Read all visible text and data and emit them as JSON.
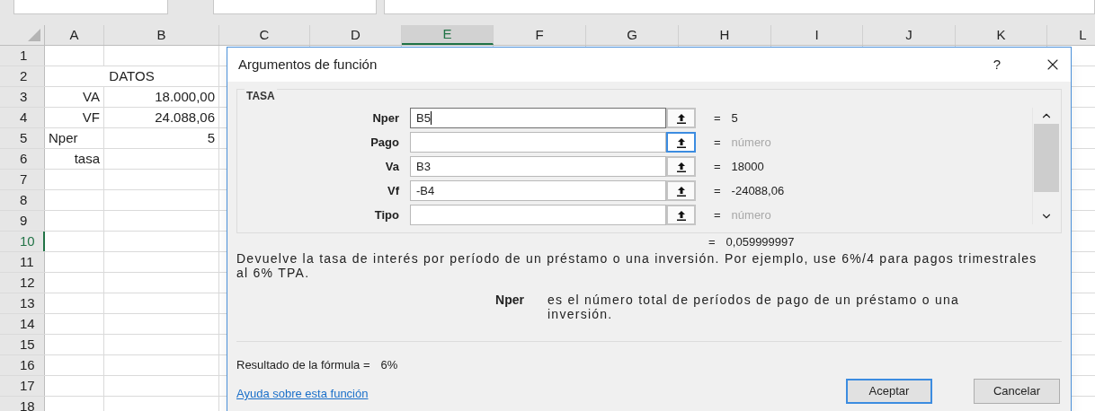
{
  "sheet": {
    "columns": [
      {
        "label": "A",
        "selected": false
      },
      {
        "label": "B",
        "selected": false
      },
      {
        "label": "C",
        "selected": false
      },
      {
        "label": "D",
        "selected": false
      },
      {
        "label": "E",
        "selected": true
      },
      {
        "label": "F",
        "selected": false
      },
      {
        "label": "G",
        "selected": false
      },
      {
        "label": "H",
        "selected": false
      },
      {
        "label": "I",
        "selected": false
      },
      {
        "label": "J",
        "selected": false
      },
      {
        "label": "K",
        "selected": false
      },
      {
        "label": "L",
        "selected": false
      }
    ],
    "rows": [
      {
        "label": "1",
        "selected": false,
        "cells": []
      },
      {
        "label": "2",
        "selected": false,
        "cells": [
          {
            "text": "DATOS",
            "kind": "merged"
          }
        ]
      },
      {
        "label": "3",
        "selected": false,
        "cells": [
          {
            "text": "VA",
            "kind": "right"
          },
          {
            "text": "18.000,00",
            "kind": "right"
          }
        ]
      },
      {
        "label": "4",
        "selected": false,
        "cells": [
          {
            "text": "VF",
            "kind": "right"
          },
          {
            "text": "24.088,06",
            "kind": "right"
          }
        ]
      },
      {
        "label": "5",
        "selected": false,
        "cells": [
          {
            "text": "Nper",
            "kind": "left"
          },
          {
            "text": "5",
            "kind": "right"
          }
        ]
      },
      {
        "label": "6",
        "selected": false,
        "cells": [
          {
            "text": "tasa",
            "kind": "right"
          }
        ]
      },
      {
        "label": "7",
        "selected": false,
        "cells": []
      },
      {
        "label": "8",
        "selected": false,
        "cells": []
      },
      {
        "label": "9",
        "selected": false,
        "cells": []
      },
      {
        "label": "10",
        "selected": true,
        "cells": []
      },
      {
        "label": "11",
        "selected": false,
        "cells": []
      },
      {
        "label": "12",
        "selected": false,
        "cells": []
      },
      {
        "label": "13",
        "selected": false,
        "cells": []
      },
      {
        "label": "14",
        "selected": false,
        "cells": []
      },
      {
        "label": "15",
        "selected": false,
        "cells": []
      },
      {
        "label": "16",
        "selected": false,
        "cells": []
      },
      {
        "label": "17",
        "selected": false,
        "cells": []
      },
      {
        "label": "18",
        "selected": false,
        "cells": []
      }
    ]
  },
  "dialog": {
    "title": "Argumentos de función",
    "help": "?",
    "group": "TASA",
    "arguments": [
      {
        "label": "Nper",
        "value": "B5",
        "focused": true,
        "ref_focused": false,
        "equals": "=",
        "result": "5",
        "kind": "value"
      },
      {
        "label": "Pago",
        "focused": false,
        "ref_focused": true,
        "equals": "=",
        "result": "número",
        "kind": "hint"
      },
      {
        "label": "Va",
        "value": "B3",
        "focused": false,
        "ref_focused": false,
        "equals": "=",
        "result": "18000",
        "kind": "value"
      },
      {
        "label": "Vf",
        "value": "-B4",
        "focused": false,
        "ref_focused": false,
        "equals": "=",
        "result": "-24088,06",
        "kind": "value"
      },
      {
        "label": "Tipo",
        "focused": false,
        "ref_focused": false,
        "equals": "=",
        "result": "número",
        "kind": "hint"
      }
    ],
    "total_equals": "=",
    "total": "0,059999997",
    "description": "Devuelve la tasa de interés por período de un préstamo o una inversión. Por ejemplo, use 6%/4 para pagos trimestrales al 6% TPA.",
    "param_name": "Nper",
    "param_description": "es el número total de períodos de pago de un préstamo o una inversión.",
    "formula_result_label": "Resultado de la fórmula =",
    "formula_result": "6%",
    "help_link": "Ayuda sobre esta función",
    "buttons": [
      {
        "label": "Aceptar",
        "default": true
      },
      {
        "label": "Cancelar",
        "default": false
      }
    ]
  }
}
